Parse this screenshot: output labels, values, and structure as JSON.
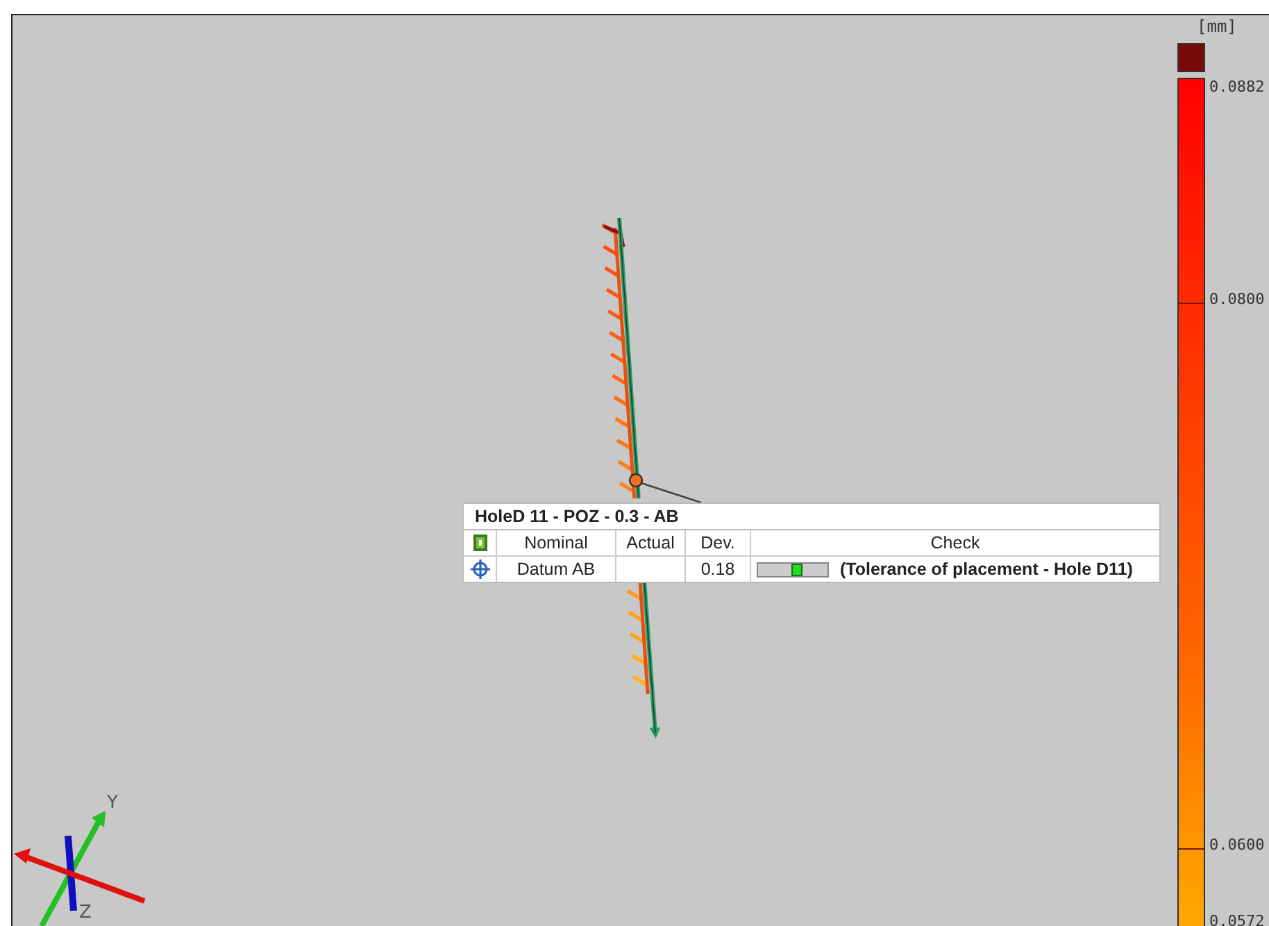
{
  "viewport": {
    "legend": {
      "unit": "[mm]",
      "ticks": [
        "0.0882",
        "0.0800",
        "0.0600",
        "0.0572"
      ]
    },
    "label": {
      "title": "HoleD 11 - POZ - 0.3 - AB",
      "columns": [
        "Nominal",
        "Actual",
        "Dev.",
        "Check"
      ],
      "rows": [
        {
          "nominal": "Datum AB",
          "deviation": "0.18",
          "check": {
            "level": 0.55,
            "text": "(Tolerance of placement - Hole D11)"
          }
        }
      ]
    },
    "triad": {
      "axes": [
        "Y",
        "Z"
      ]
    }
  }
}
